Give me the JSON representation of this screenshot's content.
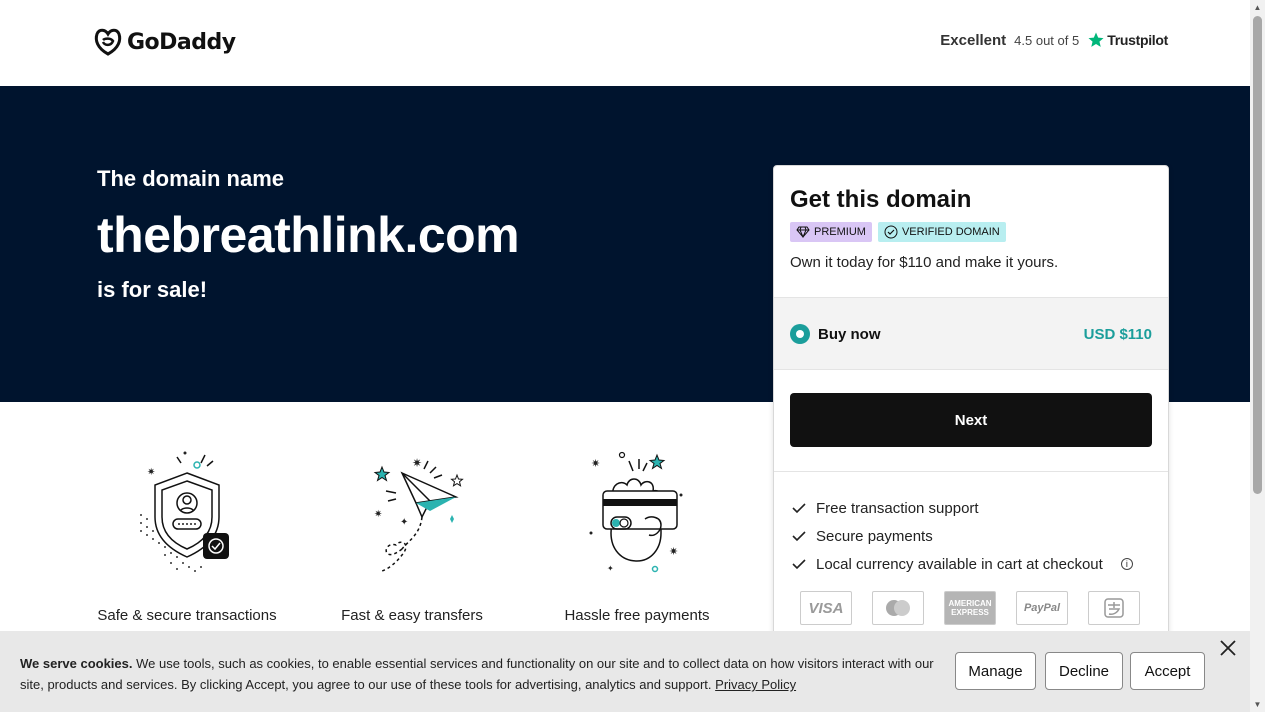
{
  "header": {
    "logo_text": "GoDaddy",
    "trust_rating_word": "Excellent",
    "trust_score": "4.5 out of 5",
    "trust_brand": "Trustpilot"
  },
  "hero": {
    "pre_title": "The domain name",
    "domain": "thebreathlink.com",
    "post_title": "is for sale!"
  },
  "features": [
    {
      "label": "Safe & secure transactions",
      "icon": "shield-user-icon"
    },
    {
      "label": "Fast & easy transfers",
      "icon": "paper-plane-icon"
    },
    {
      "label": "Hassle free payments",
      "icon": "hand-card-icon"
    }
  ],
  "card": {
    "title": "Get this domain",
    "badge_premium": "PREMIUM",
    "badge_verified": "VERIFIED DOMAIN",
    "subtitle": "Own it today for $110 and make it yours.",
    "option_label": "Buy now",
    "option_price": "USD $110",
    "next_label": "Next",
    "checks": [
      "Free transaction support",
      "Secure payments",
      "Local currency available in cart at checkout"
    ],
    "payment_methods": [
      "VISA",
      "Mastercard",
      "American Express",
      "PayPal",
      "Alipay"
    ]
  },
  "cookie": {
    "heading": "We serve cookies.",
    "body": " We use tools, such as cookies, to enable essential services and functionality on our site and to collect data on how visitors interact with our site, products and services. By clicking Accept, you agree to our use of these tools for advertising, analytics and support. ",
    "policy_link": "Privacy Policy",
    "manage": "Manage",
    "decline": "Decline",
    "accept": "Accept"
  },
  "colors": {
    "hero_bg": "#00142e",
    "accent_teal": "#1b9e9b",
    "premium_badge": "#d9c6f5",
    "verified_badge": "#b8eef0"
  }
}
